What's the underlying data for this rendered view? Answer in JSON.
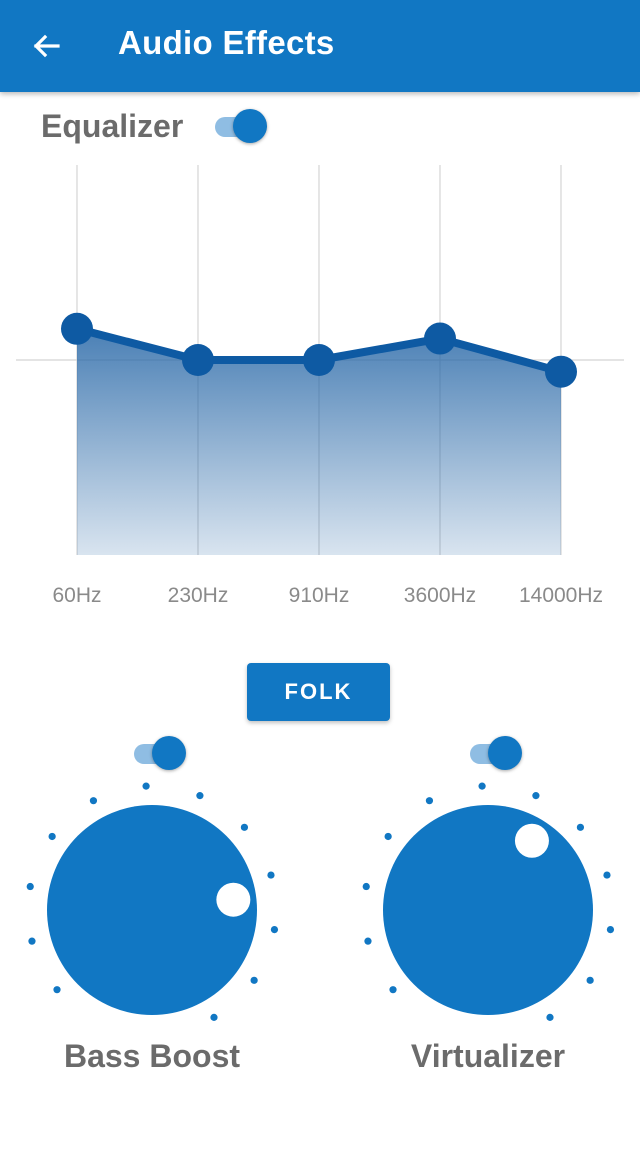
{
  "appbar": {
    "title": "Audio Effects",
    "back_icon": "arrow-left-icon",
    "color": "#1177c3"
  },
  "equalizer": {
    "label": "Equalizer",
    "enabled": true,
    "bands": [
      {
        "freq": "60Hz",
        "level": 0.16
      },
      {
        "freq": "230Hz",
        "level": 0.0
      },
      {
        "freq": "910Hz",
        "level": 0.0
      },
      {
        "freq": "3600Hz",
        "level": 0.11
      },
      {
        "freq": "14000Hz",
        "level": -0.06
      }
    ]
  },
  "preset": {
    "label": "FOLK"
  },
  "bass_boost": {
    "label": "Bass Boost",
    "enabled": true,
    "value": 0.76
  },
  "virtualizer": {
    "label": "Virtualizer",
    "enabled": true,
    "value": 0.58
  }
}
